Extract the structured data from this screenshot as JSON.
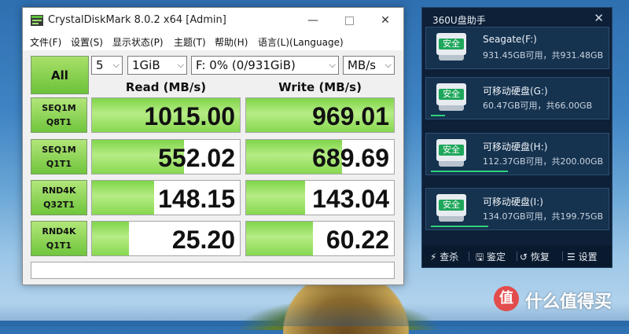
{
  "window": {
    "title": "CrystalDiskMark 8.0.2 x64 [Admin]",
    "menu": [
      "文件(F)",
      "设置(S)",
      "显示状态(P)",
      "主题(T)",
      "帮助(H)",
      "语言(L)(Language)"
    ]
  },
  "controls": {
    "all_label": "All",
    "count": "5",
    "size": "1GiB",
    "drive": "F: 0% (0/931GiB)",
    "unit": "MB/s",
    "read_header": "Read (MB/s)",
    "write_header": "Write (MB/s)"
  },
  "tests": [
    {
      "line1": "SEQ1M",
      "line2": "Q8T1",
      "read": "1015.00",
      "write": "969.01",
      "read_fill": 1.0,
      "write_fill": 1.0
    },
    {
      "line1": "SEQ1M",
      "line2": "Q1T1",
      "read": "552.02",
      "write": "689.69",
      "read_fill": 0.62,
      "write_fill": 0.65
    },
    {
      "line1": "RND4K",
      "line2": "Q32T1",
      "read": "148.15",
      "write": "143.04",
      "read_fill": 0.42,
      "write_fill": 0.4
    },
    {
      "line1": "RND4K",
      "line2": "Q1T1",
      "read": "25.20",
      "write": "60.22",
      "read_fill": 0.25,
      "write_fill": 0.45
    }
  ],
  "u360": {
    "title": "360U盘助手",
    "drives": [
      {
        "name": "Seagate(F:)",
        "capacity": "931.45GB可用，共931.48GB",
        "status": "安全",
        "usage": 0.0
      },
      {
        "name": "可移动硬盘(G:)",
        "capacity": "60.47GB可用，共66.00GB",
        "status": "安全",
        "usage": 0.08
      },
      {
        "name": "可移动硬盘(H:)",
        "capacity": "112.37GB可用，共200.00GB",
        "status": "安全",
        "usage": 0.44
      },
      {
        "name": "可移动硬盘(I:)",
        "capacity": "134.07GB可用，共199.75GB",
        "status": "安全",
        "usage": 0.33
      }
    ],
    "footer": [
      "查杀",
      "鉴定",
      "恢复",
      "设置"
    ]
  },
  "watermark": "什么值得买",
  "watermark_icon": "值",
  "colors": {
    "accent_green": "#6cc23a",
    "panel_bg": "#0d2038",
    "safe_green": "#1ea75b"
  }
}
